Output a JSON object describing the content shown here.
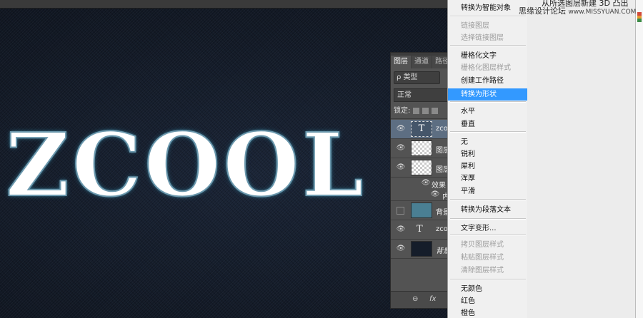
{
  "canvas_text": "ZCOOL",
  "layers_panel": {
    "tabs": [
      "图层",
      "通道",
      "路径"
    ],
    "filter_label": "ρ 类型",
    "blend_mode": "正常",
    "lock_label": "锁定:",
    "layers": [
      {
        "name": "zco",
        "type": "text-selected"
      },
      {
        "name": "图层",
        "type": "zcool-thumb"
      },
      {
        "name": "图层",
        "type": "zcool-thumb"
      },
      {
        "name": "效果",
        "type": "effects"
      },
      {
        "name": "内",
        "type": "effect-item"
      },
      {
        "name": "背景",
        "type": "fill"
      },
      {
        "name": "zco",
        "type": "text"
      },
      {
        "name": "背景",
        "type": "dark"
      }
    ],
    "footer": "fx"
  },
  "context_menu": {
    "items": [
      {
        "label": "转换为智能对象",
        "state": "normal"
      },
      {
        "label": "链接图层",
        "state": "disabled"
      },
      {
        "label": "选择链接图层",
        "state": "disabled"
      },
      {
        "label": "栅格化文字",
        "state": "normal"
      },
      {
        "label": "栅格化图层样式",
        "state": "disabled"
      },
      {
        "label": "创建工作路径",
        "state": "normal"
      },
      {
        "label": "转换为形状",
        "state": "highlighted"
      },
      {
        "label": "水平",
        "state": "normal"
      },
      {
        "label": "垂直",
        "state": "normal"
      },
      {
        "label": "无",
        "state": "normal"
      },
      {
        "label": "锐利",
        "state": "normal"
      },
      {
        "label": "犀利",
        "state": "normal"
      },
      {
        "label": "浑厚",
        "state": "normal"
      },
      {
        "label": "平滑",
        "state": "normal"
      },
      {
        "label": "转换为段落文本",
        "state": "normal"
      },
      {
        "label": "文字变形...",
        "state": "normal"
      },
      {
        "label": "拷贝图层样式",
        "state": "disabled"
      },
      {
        "label": "粘贴图层样式",
        "state": "disabled"
      },
      {
        "label": "清除图层样式",
        "state": "disabled"
      },
      {
        "label": "无颜色",
        "state": "normal"
      },
      {
        "label": "红色",
        "state": "normal"
      },
      {
        "label": "橙色",
        "state": "normal"
      }
    ]
  },
  "right_panel": {
    "top_text": "从所选图层新建 3D 凸出",
    "watermark": "思缘设计论坛",
    "watermark_url": "www.MISSYUAN.COM"
  },
  "colors": {
    "highlight": "#3399ff",
    "selected_layer": "#5d6e82",
    "background_layer_fill": "#4a7f93",
    "canvas_bg": "#131a26"
  }
}
